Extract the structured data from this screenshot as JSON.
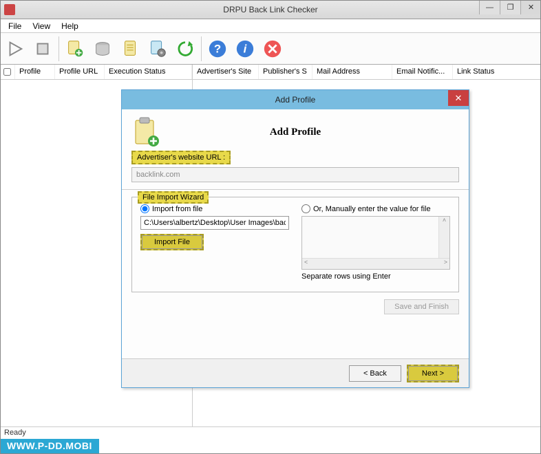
{
  "app": {
    "title": "DRPU Back Link Checker"
  },
  "menu": {
    "file": "File",
    "view": "View",
    "help": "Help"
  },
  "columns": {
    "left": {
      "profile": "Profile",
      "profile_url": "Profile URL",
      "exec": "Execution Status"
    },
    "right": {
      "adv": "Advertiser's Site",
      "pub": "Publisher's S",
      "mail": "Mail Address",
      "email_notif": "Email Notific...",
      "link_status": "Link Status"
    }
  },
  "status": "Ready",
  "watermark": "WWW.P-DD.MOBI",
  "dialog": {
    "title": "Add Profile",
    "header": "Add Profile",
    "adv_label": "Advertiser's website URL :",
    "adv_value": "backlink.com",
    "wizard_legend": "File Import Wizard",
    "radio_file": "Import from file",
    "radio_manual": "Or, Manually enter the value for file",
    "path": "C:\\Users\\albertz\\Desktop\\User Images\\backlinl",
    "import_btn": "Import File",
    "hint": "Separate rows using Enter",
    "save_finish": "Save and Finish",
    "back": "< Back",
    "next": "Next >"
  }
}
